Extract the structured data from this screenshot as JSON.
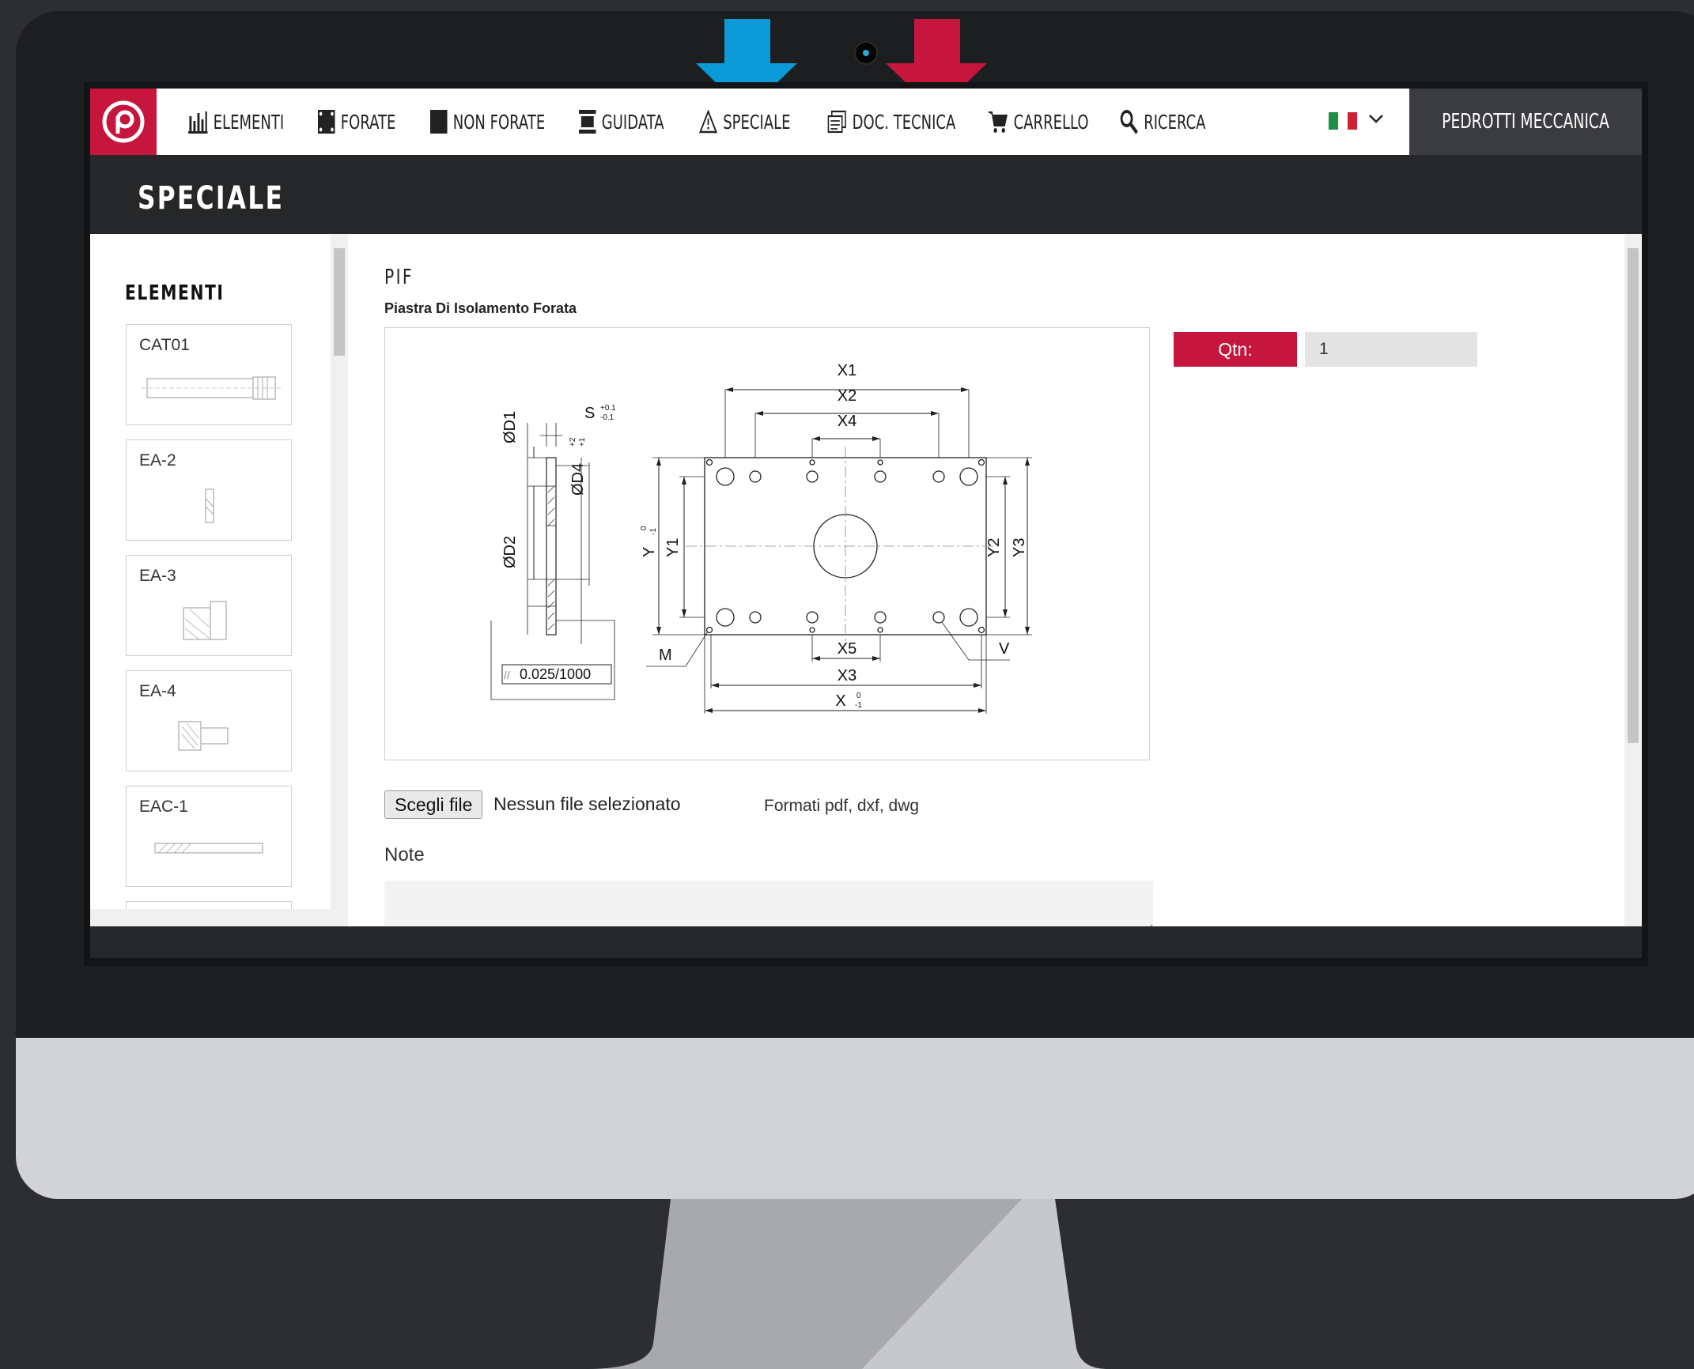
{
  "nav": {
    "items": [
      {
        "label": "ELEMENTI",
        "icon": "bar-chart-icon"
      },
      {
        "label": "FORATE",
        "icon": "perforated-square-icon"
      },
      {
        "label": "NON FORATE",
        "icon": "solid-square-icon"
      },
      {
        "label": "GUIDATA",
        "icon": "guide-stack-icon"
      },
      {
        "label": "SPECIALE",
        "icon": "warning-triangle-icon"
      },
      {
        "label": "DOC. TECNICA",
        "icon": "documents-icon"
      },
      {
        "label": "CARRELLO",
        "icon": "cart-icon"
      },
      {
        "label": "RICERCA",
        "icon": "search-icon"
      }
    ],
    "language": "it",
    "account_label": "PEDROTTI MECCANICA"
  },
  "page": {
    "title": "SPECIALE"
  },
  "sidebar": {
    "heading": "ELEMENTI",
    "items": [
      {
        "label": "CAT01"
      },
      {
        "label": "EA-2"
      },
      {
        "label": "EA-3"
      },
      {
        "label": "EA-4"
      },
      {
        "label": "EAC-1"
      }
    ]
  },
  "product": {
    "code": "PIF",
    "name": "Piastra Di Isolamento Forata",
    "drawing_labels": {
      "x1": "X1",
      "x2": "X2",
      "x4": "X4",
      "x5": "X5",
      "x3": "X3",
      "x": "X",
      "y1": "Y1",
      "y2": "Y2",
      "y3": "Y3",
      "y": "Y",
      "d1": "ØD1",
      "d2": "ØD2",
      "d4": "ØD4",
      "s": "S",
      "m": "M",
      "v": "V",
      "tol_s_plus": "+0.1",
      "tol_s_minus": "-0.1",
      "tol_d4_plus": "+2",
      "tol_d4_minus": "+1",
      "tol_zero": "0",
      "tol_minus1": "-1",
      "parallelism": "0.025/1000",
      "parallelism_symbol": "//"
    }
  },
  "order": {
    "qty_label": "Qtn:",
    "qty_value": "1"
  },
  "upload": {
    "button_label": "Scegli file",
    "status": "Nessun file selezionato",
    "formats": "Formati pdf, dxf, dwg"
  },
  "note": {
    "label": "Note",
    "value": ""
  },
  "colors": {
    "brand_red": "#c6163d",
    "arrow_blue": "#0a9ad7",
    "dark": "#262729"
  }
}
